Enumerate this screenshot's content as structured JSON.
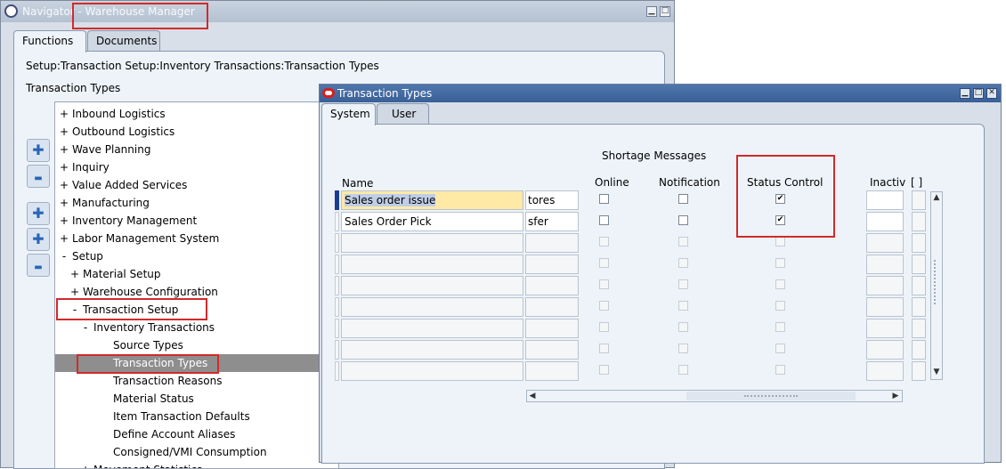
{
  "navigator": {
    "title": "Navigator - Warehouse Manager",
    "tabs": [
      {
        "label": "Functions",
        "active": true
      },
      {
        "label": "Documents",
        "active": false
      }
    ],
    "path": "Setup:Transaction Setup:Inventory Transactions:Transaction Types",
    "section_label": "Transaction Types",
    "tree": [
      {
        "label": "Inbound Logistics",
        "expander": "+",
        "level": 0
      },
      {
        "label": "Outbound Logistics",
        "expander": "+",
        "level": 0
      },
      {
        "label": "Wave Planning",
        "expander": "+",
        "level": 0
      },
      {
        "label": "Inquiry",
        "expander": "+",
        "level": 0
      },
      {
        "label": "Value Added Services",
        "expander": "+",
        "level": 0
      },
      {
        "label": "Manufacturing",
        "expander": "+",
        "level": 0
      },
      {
        "label": "Inventory Management",
        "expander": "+",
        "level": 0
      },
      {
        "label": "Labor Management System",
        "expander": "+",
        "level": 0
      },
      {
        "label": "Setup",
        "expander": "-",
        "level": 0
      },
      {
        "label": "Material Setup",
        "expander": "+",
        "level": 1
      },
      {
        "label": "Warehouse Configuration",
        "expander": "+",
        "level": 1
      },
      {
        "label": "Transaction Setup",
        "expander": "-",
        "level": 1
      },
      {
        "label": "Inventory Transactions",
        "expander": "-",
        "level": 2
      },
      {
        "label": "Source Types",
        "expander": "",
        "level": 3
      },
      {
        "label": "Transaction Types",
        "expander": "",
        "level": 3,
        "selected": true
      },
      {
        "label": "Transaction Reasons",
        "expander": "",
        "level": 3
      },
      {
        "label": "Material Status",
        "expander": "",
        "level": 3
      },
      {
        "label": "Item Transaction Defaults",
        "expander": "",
        "level": 3
      },
      {
        "label": "Define Account Aliases",
        "expander": "",
        "level": 3
      },
      {
        "label": "Consigned/VMI Consumption",
        "expander": "",
        "level": 3
      },
      {
        "label": "Movement Statistics",
        "expander": "+",
        "level": 2
      }
    ],
    "side_buttons": [
      {
        "icon": "expand-icon",
        "glyph": "✚"
      },
      {
        "icon": "collapse-icon",
        "glyph": "▬"
      },
      {
        "icon": "expand-branch-icon",
        "glyph": "✚"
      },
      {
        "icon": "expand-all-icon",
        "glyph": "✚"
      },
      {
        "icon": "collapse-all-icon",
        "glyph": "▬"
      }
    ]
  },
  "transaction_types": {
    "title": "Transaction Types",
    "tabs": [
      {
        "label": "System",
        "active": true
      },
      {
        "label": "User",
        "active": false
      }
    ],
    "group_header": "Shortage Messages",
    "columns": {
      "name": "Name",
      "online": "Online",
      "notification": "Notification",
      "status_control": "Status Control",
      "inactive": "Inactiv",
      "flex": "[ ]"
    },
    "rows": [
      {
        "name": "Sales order issue",
        "description": "tores",
        "online": false,
        "notification": false,
        "status_control": true,
        "current": true
      },
      {
        "name": "Sales Order Pick",
        "description": "sfer",
        "online": false,
        "notification": false,
        "status_control": true,
        "current": false
      },
      {
        "name": "",
        "description": "",
        "online": false,
        "notification": false,
        "status_control": false
      },
      {
        "name": "",
        "description": "",
        "online": false,
        "notification": false,
        "status_control": false
      },
      {
        "name": "",
        "description": "",
        "online": false,
        "notification": false,
        "status_control": false
      },
      {
        "name": "",
        "description": "",
        "online": false,
        "notification": false,
        "status_control": false
      },
      {
        "name": "",
        "description": "",
        "online": false,
        "notification": false,
        "status_control": false
      },
      {
        "name": "",
        "description": "",
        "online": false,
        "notification": false,
        "status_control": false
      },
      {
        "name": "",
        "description": "",
        "online": false,
        "notification": false,
        "status_control": false
      }
    ],
    "check_glyph": "✔",
    "scroll_up_glyph": "▲",
    "scroll_down_glyph": "▼",
    "scroll_left_glyph": "◀",
    "scroll_right_glyph": "▶"
  },
  "colors": {
    "highlight_border": "#d12a2a",
    "active_titlebar": "#3a5f97",
    "selected_tree_row": "#8e8e8e",
    "current_record": "#ffe9a6"
  }
}
